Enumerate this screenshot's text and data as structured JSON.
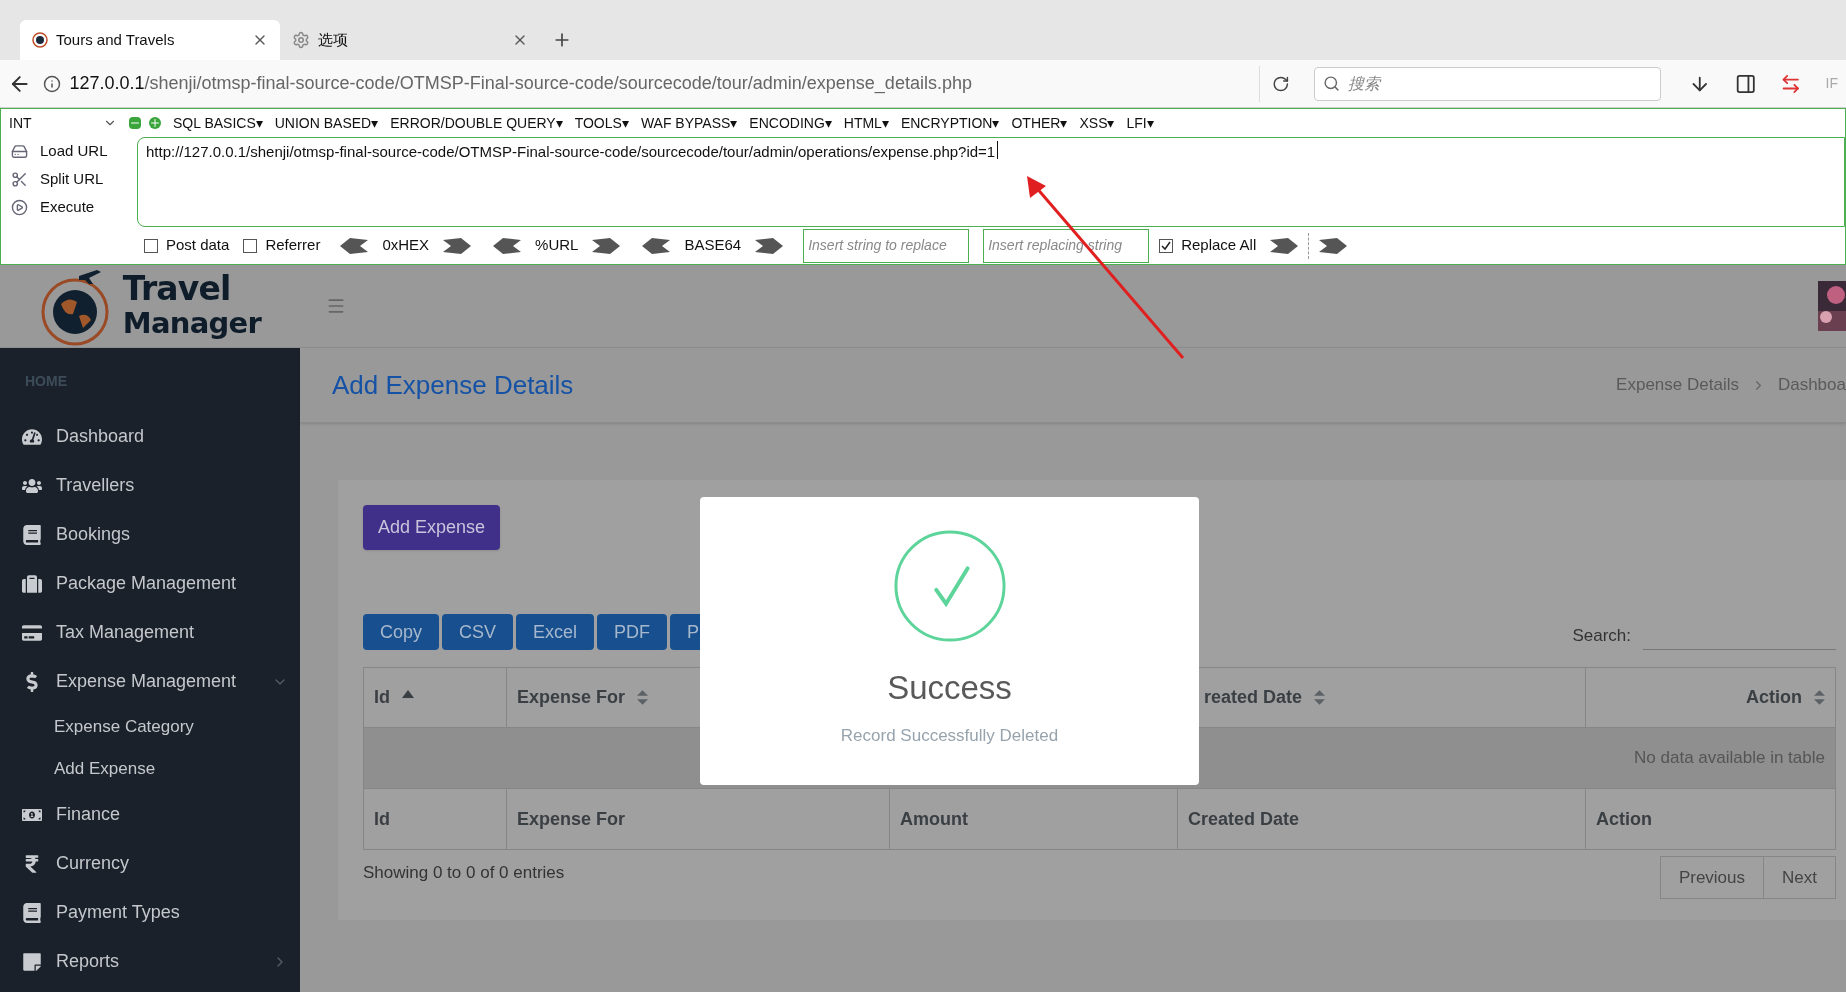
{
  "browser": {
    "tabs": [
      {
        "title": "Tours and Travels",
        "selected": true
      },
      {
        "title": "选项",
        "selected": false
      }
    ],
    "address": {
      "host": "127.0.0.1",
      "path": "/shenji/otmsp-final-source-code/OTMSP-Final-source-code/sourcecode/tour/admin/expense_details.php"
    },
    "search": {
      "placeholder": "搜索"
    },
    "edge_label": "IF"
  },
  "hackbar": {
    "select": "INT",
    "menus": [
      "SQL BASICS▾",
      "UNION BASED▾",
      "ERROR/DOUBLE QUERY▾",
      "TOOLS▾",
      "WAF BYPASS▾",
      "ENCODING▾",
      "HTML▾",
      "ENCRYPTION▾",
      "OTHER▾",
      "XSS▾",
      "LFI▾"
    ],
    "actions": [
      "Load URL",
      "Split URL",
      "Execute"
    ],
    "url": "http://127.0.0.1/shenji/otmsp-final-source-code/OTMSP-Final-source-code/sourcecode/tour/admin/operations/expense.php?id=1",
    "options": [
      {
        "kind": "checkbox",
        "label": "Post data",
        "checked": false
      },
      {
        "kind": "checkbox",
        "label": "Referrer",
        "checked": false
      },
      {
        "kind": "encoder",
        "label": "0xHEX"
      },
      {
        "kind": "encoder",
        "label": "%URL"
      },
      {
        "kind": "encoder",
        "label": "BASE64"
      },
      {
        "kind": "field",
        "placeholder": "Insert string to replace"
      },
      {
        "kind": "field",
        "placeholder": "Insert replacing string"
      },
      {
        "kind": "checkbox",
        "label": "Replace All",
        "checked": true
      }
    ]
  },
  "app": {
    "logo": {
      "line1": "Travel",
      "line2": "Manager"
    },
    "sidebar": {
      "heading": "HOME",
      "items": [
        {
          "label": "Dashboard"
        },
        {
          "label": "Travellers"
        },
        {
          "label": "Bookings"
        },
        {
          "label": "Package Management"
        },
        {
          "label": "Tax Management"
        },
        {
          "label": "Expense Management",
          "expanded": true,
          "children": [
            {
              "label": "Expense Category"
            },
            {
              "label": "Add Expense"
            }
          ]
        },
        {
          "label": "Finance"
        },
        {
          "label": "Currency"
        },
        {
          "label": "Payment Types"
        },
        {
          "label": "Reports",
          "expanded": false
        }
      ]
    },
    "page_title": "Add Expense Details",
    "breadcrumb": [
      "Expense Details",
      "Dashboa"
    ],
    "add_button": "Add Expense",
    "export_buttons": [
      "Copy",
      "CSV",
      "Excel",
      "PDF",
      "P"
    ],
    "search_label": "Search:",
    "table": {
      "columns": [
        {
          "label": "Id",
          "sorted": true
        },
        {
          "label": "Expense For",
          "sorted": false
        },
        {
          "label": "reated Date",
          "sorted": false
        },
        {
          "label": "Action",
          "sorted": false
        }
      ],
      "empty_message": "No data available in table",
      "footer_columns": [
        "Id",
        "Expense For",
        "Amount",
        "Created Date",
        "Action"
      ]
    },
    "info": "Showing 0 to 0 of 0 entries",
    "pagination": [
      "Previous",
      "Next"
    ],
    "dialog": {
      "title": "Success",
      "message": "Record Successfully Deleted"
    }
  }
}
